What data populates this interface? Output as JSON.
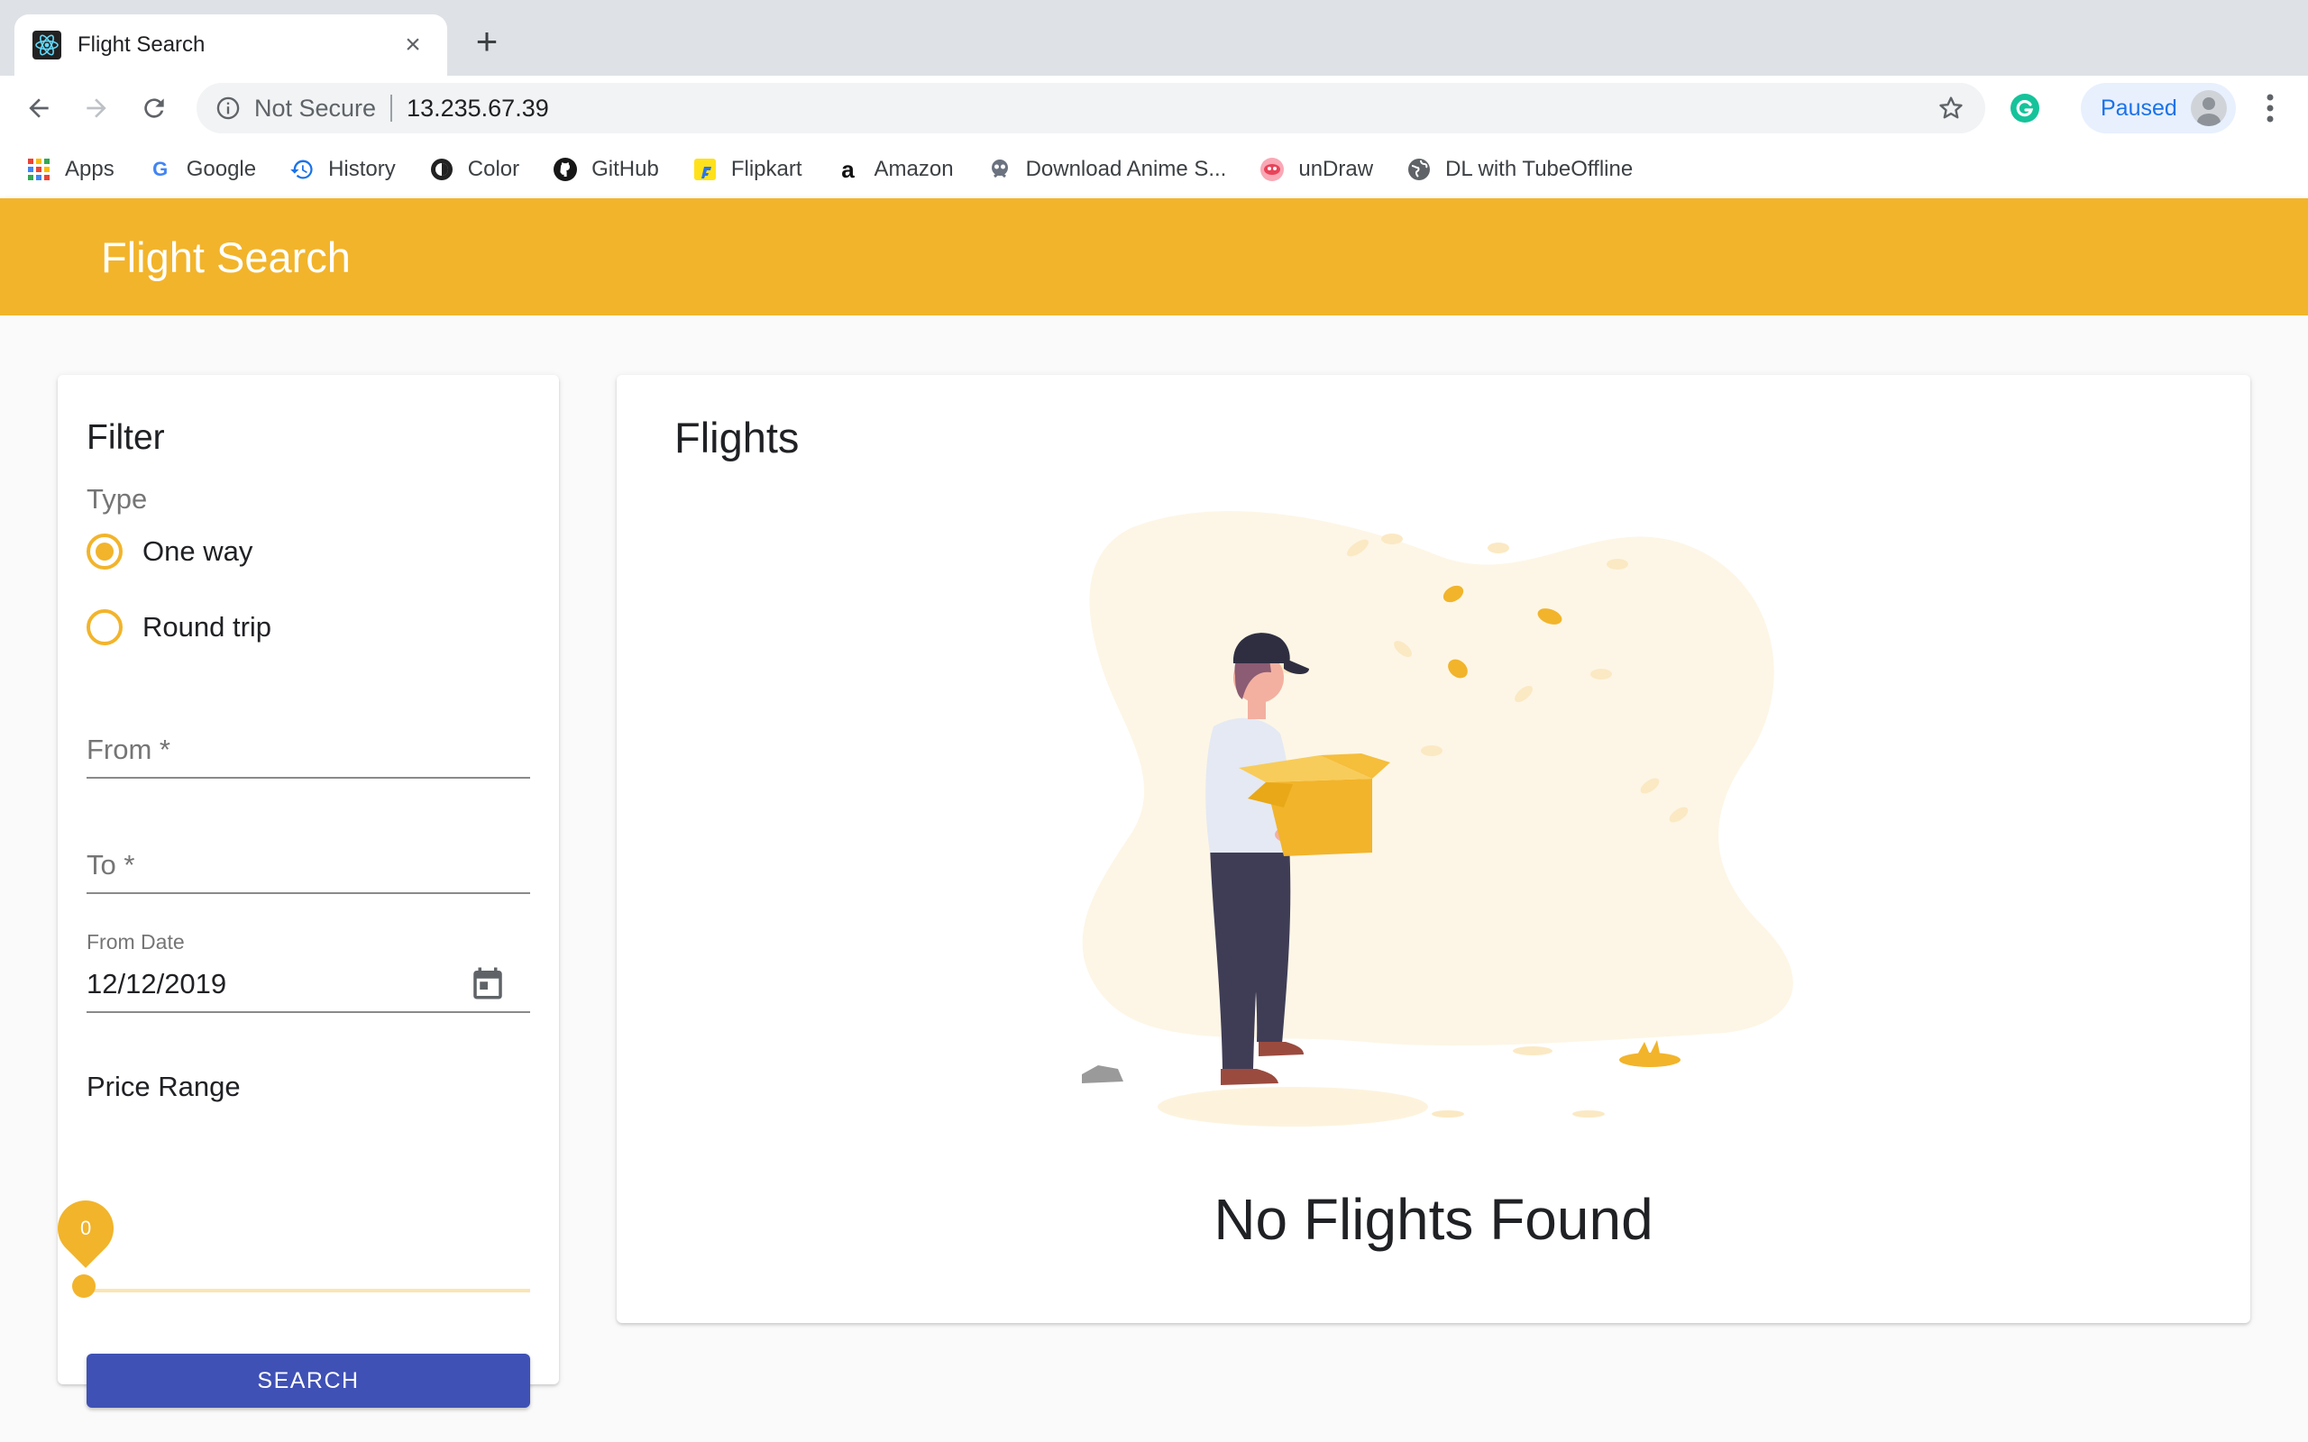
{
  "browser": {
    "tab_title": "Flight Search",
    "tab_close": "×",
    "new_tab": "+",
    "security_label": "Not Secure",
    "url": "13.235.67.39",
    "profile_status": "Paused"
  },
  "bookmarks": [
    {
      "label": "Apps",
      "icon": "apps-grid-icon"
    },
    {
      "label": "Google",
      "icon": "google-icon"
    },
    {
      "label": "History",
      "icon": "history-icon"
    },
    {
      "label": "Color",
      "icon": "color-icon"
    },
    {
      "label": "GitHub",
      "icon": "github-icon"
    },
    {
      "label": "Flipkart",
      "icon": "flipkart-icon"
    },
    {
      "label": "Amazon",
      "icon": "amazon-icon"
    },
    {
      "label": "Download Anime S...",
      "icon": "anime-icon"
    },
    {
      "label": "unDraw",
      "icon": "undraw-icon"
    },
    {
      "label": "DL with TubeOffline",
      "icon": "globe-icon"
    }
  ],
  "app": {
    "title": "Flight Search",
    "accent_color": "#f2b42b",
    "primary_color": "#3f51b5"
  },
  "filter": {
    "title": "Filter",
    "type_label": "Type",
    "options": [
      {
        "label": "One way",
        "selected": true
      },
      {
        "label": "Round trip",
        "selected": false
      }
    ],
    "from_placeholder": "From *",
    "to_placeholder": "To *",
    "from_date_label": "From Date",
    "from_date_value": "12/12/2019",
    "price_label": "Price Range",
    "price_value": "0",
    "search_label": "SEARCH"
  },
  "flights": {
    "title": "Flights",
    "empty_message": "No Flights Found"
  }
}
